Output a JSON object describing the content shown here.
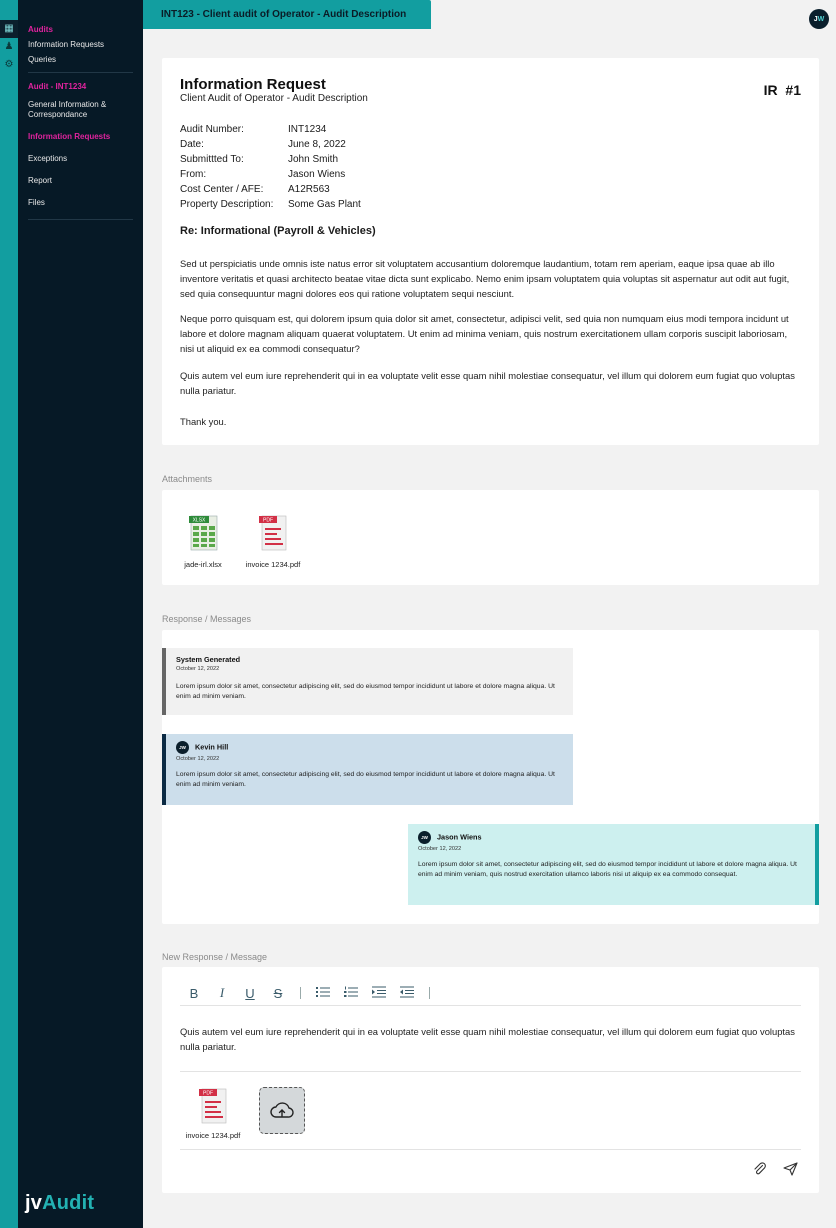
{
  "window": {
    "title": "INT123 - Client audit of Operator - Audit Description"
  },
  "user": {
    "initial_j": "J",
    "initial_w": "W"
  },
  "sidebar": {
    "section1": {
      "head": "Audits",
      "items": [
        "Information Requests",
        "Queries"
      ]
    },
    "section2": {
      "head": "Audit - INT1234",
      "items": [
        "General Information &",
        "Correspondance"
      ],
      "active": "Information Requests",
      "rest": [
        "Exceptions",
        "Report",
        "Files"
      ]
    },
    "logo_main": "jv",
    "logo_accent": "Audit"
  },
  "request": {
    "title": "Information Request",
    "subtitle": "Client Audit of Operator - Audit Description",
    "ir_label": "IR  #1",
    "meta": [
      {
        "k": "Audit Number:",
        "v": "INT1234"
      },
      {
        "k": "Date:",
        "v": "June 8, 2022"
      },
      {
        "k": "Submittted To:",
        "v": "John Smith"
      },
      {
        "k": "From:",
        "v": "Jason Wiens"
      },
      {
        "k": "Cost Center / AFE:",
        "v": "A12R563"
      },
      {
        "k": "Property Description:",
        "v": "Some Gas Plant"
      }
    ],
    "re": "Re: Informational (Payroll & Vehicles)",
    "p1": "Sed ut perspiciatis unde omnis iste natus error sit voluptatem accusantium doloremque laudantium, totam rem aperiam, eaque ipsa quae ab illo inventore veritatis et quasi architecto beatae vitae dicta sunt explicabo. Nemo enim ipsam voluptatem quia voluptas sit aspernatur aut odit aut fugit, sed quia consequuntur magni dolores eos qui ratione voluptatem sequi nesciunt.",
    "p2": "Neque porro quisquam est, qui dolorem ipsum quia dolor sit amet, consectetur, adipisci velit, sed quia non numquam eius modi tempora incidunt ut labore et dolore magnam aliquam quaerat voluptatem. Ut enim ad minima veniam, quis nostrum exercitationem ullam corporis suscipit laboriosam, nisi ut aliquid ex ea commodi consequatur?",
    "p3": "Quis autem vel eum iure reprehenderit qui in ea voluptate velit esse quam nihil molestiae consequatur, vel illum qui dolorem eum fugiat quo voluptas nulla pariatur.",
    "p4": "Thank you."
  },
  "attachments": {
    "label": "Attachments",
    "files": [
      {
        "name": "jade-irl.xlsx",
        "badge": "XLSX"
      },
      {
        "name": "invoice 1234.pdf",
        "badge": "PDF"
      }
    ]
  },
  "messages": {
    "label": "Response / Messages",
    "items": [
      {
        "who": "System Generated",
        "date": "October 12, 2022",
        "text": "Lorem ipsum dolor sit amet, consectetur adipiscing elit, sed do eiusmod tempor incididunt ut labore et dolore magna aliqua. Ut enim ad minim veniam."
      },
      {
        "who": "Kevin Hill",
        "avatar": "JW",
        "date": "October 12, 2022",
        "text": "Lorem ipsum dolor sit amet, consectetur adipiscing elit, sed do eiusmod tempor incididunt ut labore et dolore magna aliqua. Ut enim ad minim veniam."
      },
      {
        "who": "Jason Wiens",
        "avatar": "JW",
        "date": "October 12, 2022",
        "text": "Lorem ipsum dolor sit amet, consectetur adipiscing elit, sed do eiusmod tempor incididunt ut labore et dolore magna aliqua. Ut enim ad minim veniam, quis nostrud exercitation ullamco laboris nisi ut aliquip ex ea commodo consequat."
      }
    ]
  },
  "composer": {
    "label": "New Response / Message",
    "text": "Quis autem vel eum iure reprehenderit qui in ea voluptate velit esse quam nihil molestiae consequatur, vel illum qui dolorem eum fugiat quo voluptas nulla pariatur.",
    "toolbar": {
      "bold": "B",
      "italic": "I",
      "underline": "U",
      "strike": "S"
    },
    "attachment": {
      "name": "invoice 1234.pdf",
      "badge": "PDF"
    }
  },
  "colors": {
    "accent": "#129ea0",
    "magenta": "#e0239e",
    "sidebar": "#061926"
  }
}
